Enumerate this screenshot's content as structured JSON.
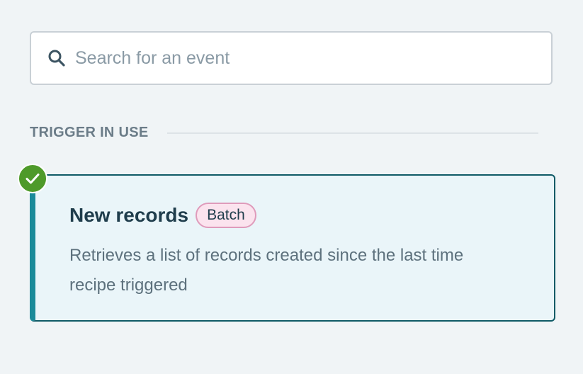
{
  "search": {
    "placeholder": "Search for an event",
    "icon": "search-icon"
  },
  "section": {
    "title": "TRIGGER IN USE"
  },
  "trigger_card": {
    "title": "New records",
    "badge": "Batch",
    "description": "Retrieves a list of records created since the last time recipe triggered",
    "status_icon": "check-circle-icon",
    "selected": true
  },
  "colors": {
    "background": "#f0f4f6",
    "card_background": "#eaf5f9",
    "card_accent": "#1a8a99",
    "check": "#4e9a2a",
    "badge_bg": "#fbe3ee",
    "badge_border": "#df9bbb"
  }
}
